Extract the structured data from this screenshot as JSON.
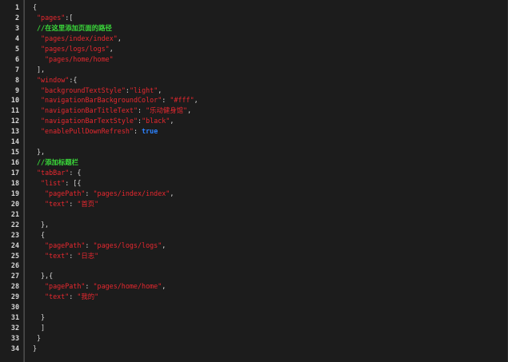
{
  "editor": {
    "lines": [
      {
        "n": "1",
        "indent": 0,
        "tokens": [
          {
            "t": "{",
            "k": "punc"
          }
        ]
      },
      {
        "n": "2",
        "indent": 1,
        "tokens": [
          {
            "t": "\"pages\"",
            "k": "str"
          },
          {
            "t": ":[",
            "k": "punc"
          }
        ]
      },
      {
        "n": "3",
        "indent": 1,
        "tokens": [
          {
            "t": "//在这里添加页面的路径",
            "k": "comment"
          }
        ]
      },
      {
        "n": "4",
        "indent": 2,
        "tokens": [
          {
            "t": "\"pages/index/index\"",
            "k": "str"
          },
          {
            "t": ",",
            "k": "punc"
          }
        ]
      },
      {
        "n": "5",
        "indent": 2,
        "tokens": [
          {
            "t": "\"pages/logs/logs\"",
            "k": "str"
          },
          {
            "t": ",",
            "k": "punc"
          }
        ]
      },
      {
        "n": "6",
        "indent": 3,
        "tokens": [
          {
            "t": "\"pages/home/home\"",
            "k": "str"
          }
        ]
      },
      {
        "n": "7",
        "indent": 1,
        "tokens": [
          {
            "t": "],",
            "k": "punc"
          }
        ]
      },
      {
        "n": "8",
        "indent": 1,
        "tokens": [
          {
            "t": "\"window\"",
            "k": "str"
          },
          {
            "t": ":{",
            "k": "punc"
          }
        ]
      },
      {
        "n": "9",
        "indent": 2,
        "tokens": [
          {
            "t": "\"backgroundTextStyle\"",
            "k": "str"
          },
          {
            "t": ":",
            "k": "punc"
          },
          {
            "t": "\"light\"",
            "k": "str"
          },
          {
            "t": ",",
            "k": "punc"
          }
        ]
      },
      {
        "n": "10",
        "indent": 2,
        "tokens": [
          {
            "t": "\"navigationBarBackgroundColor\"",
            "k": "str"
          },
          {
            "t": ": ",
            "k": "punc"
          },
          {
            "t": "\"#fff\"",
            "k": "str"
          },
          {
            "t": ",",
            "k": "punc"
          }
        ]
      },
      {
        "n": "11",
        "indent": 2,
        "tokens": [
          {
            "t": "\"navigationBarTitleText\"",
            "k": "str"
          },
          {
            "t": ": ",
            "k": "punc"
          },
          {
            "t": "\"乐动健身馆\"",
            "k": "str"
          },
          {
            "t": ",",
            "k": "punc"
          }
        ]
      },
      {
        "n": "12",
        "indent": 2,
        "tokens": [
          {
            "t": "\"navigationBarTextStyle\"",
            "k": "str"
          },
          {
            "t": ":",
            "k": "punc"
          },
          {
            "t": "\"black\"",
            "k": "str"
          },
          {
            "t": ",",
            "k": "punc"
          }
        ]
      },
      {
        "n": "13",
        "indent": 2,
        "tokens": [
          {
            "t": "\"enablePullDownRefresh\"",
            "k": "str"
          },
          {
            "t": ": ",
            "k": "punc"
          },
          {
            "t": "true",
            "k": "bool"
          }
        ]
      },
      {
        "n": "14",
        "indent": 0,
        "tokens": []
      },
      {
        "n": "15",
        "indent": 1,
        "tokens": [
          {
            "t": "},",
            "k": "punc"
          }
        ]
      },
      {
        "n": "16",
        "indent": 1,
        "tokens": [
          {
            "t": "//添加标题栏",
            "k": "comment"
          }
        ]
      },
      {
        "n": "17",
        "indent": 1,
        "tokens": [
          {
            "t": "\"tabBar\"",
            "k": "str"
          },
          {
            "t": ": {",
            "k": "punc"
          }
        ]
      },
      {
        "n": "18",
        "indent": 2,
        "tokens": [
          {
            "t": "\"list\"",
            "k": "str"
          },
          {
            "t": ": [{",
            "k": "punc"
          }
        ]
      },
      {
        "n": "19",
        "indent": 3,
        "tokens": [
          {
            "t": "\"pagePath\"",
            "k": "str"
          },
          {
            "t": ": ",
            "k": "punc"
          },
          {
            "t": "\"pages/index/index\"",
            "k": "str"
          },
          {
            "t": ",",
            "k": "punc"
          }
        ]
      },
      {
        "n": "20",
        "indent": 3,
        "tokens": [
          {
            "t": "\"text\"",
            "k": "str"
          },
          {
            "t": ": ",
            "k": "punc"
          },
          {
            "t": "\"首页\"",
            "k": "str"
          }
        ]
      },
      {
        "n": "21",
        "indent": 0,
        "tokens": []
      },
      {
        "n": "22",
        "indent": 2,
        "tokens": [
          {
            "t": "},",
            "k": "punc"
          }
        ]
      },
      {
        "n": "23",
        "indent": 2,
        "tokens": [
          {
            "t": "{",
            "k": "punc"
          }
        ]
      },
      {
        "n": "24",
        "indent": 3,
        "tokens": [
          {
            "t": "\"pagePath\"",
            "k": "str"
          },
          {
            "t": ": ",
            "k": "punc"
          },
          {
            "t": "\"pages/logs/logs\"",
            "k": "str"
          },
          {
            "t": ",",
            "k": "punc"
          }
        ]
      },
      {
        "n": "25",
        "indent": 3,
        "tokens": [
          {
            "t": "\"text\"",
            "k": "str"
          },
          {
            "t": ": ",
            "k": "punc"
          },
          {
            "t": "\"日志\"",
            "k": "str"
          }
        ]
      },
      {
        "n": "26",
        "indent": 0,
        "tokens": []
      },
      {
        "n": "27",
        "indent": 2,
        "tokens": [
          {
            "t": "},{",
            "k": "punc"
          }
        ]
      },
      {
        "n": "28",
        "indent": 3,
        "tokens": [
          {
            "t": "\"pagePath\"",
            "k": "str"
          },
          {
            "t": ": ",
            "k": "punc"
          },
          {
            "t": "\"pages/home/home\"",
            "k": "str"
          },
          {
            "t": ",",
            "k": "punc"
          }
        ]
      },
      {
        "n": "29",
        "indent": 3,
        "tokens": [
          {
            "t": "\"text\"",
            "k": "str"
          },
          {
            "t": ": ",
            "k": "punc"
          },
          {
            "t": "\"我的\"",
            "k": "str"
          }
        ]
      },
      {
        "n": "30",
        "indent": 0,
        "tokens": []
      },
      {
        "n": "31",
        "indent": 2,
        "tokens": [
          {
            "t": "}",
            "k": "punc"
          }
        ]
      },
      {
        "n": "32",
        "indent": 2,
        "tokens": [
          {
            "t": "]",
            "k": "punc"
          }
        ]
      },
      {
        "n": "33",
        "indent": 1,
        "tokens": [
          {
            "t": "}",
            "k": "punc"
          }
        ]
      },
      {
        "n": "34",
        "indent": 0,
        "tokens": [
          {
            "t": "}",
            "k": "punc"
          }
        ]
      }
    ]
  }
}
